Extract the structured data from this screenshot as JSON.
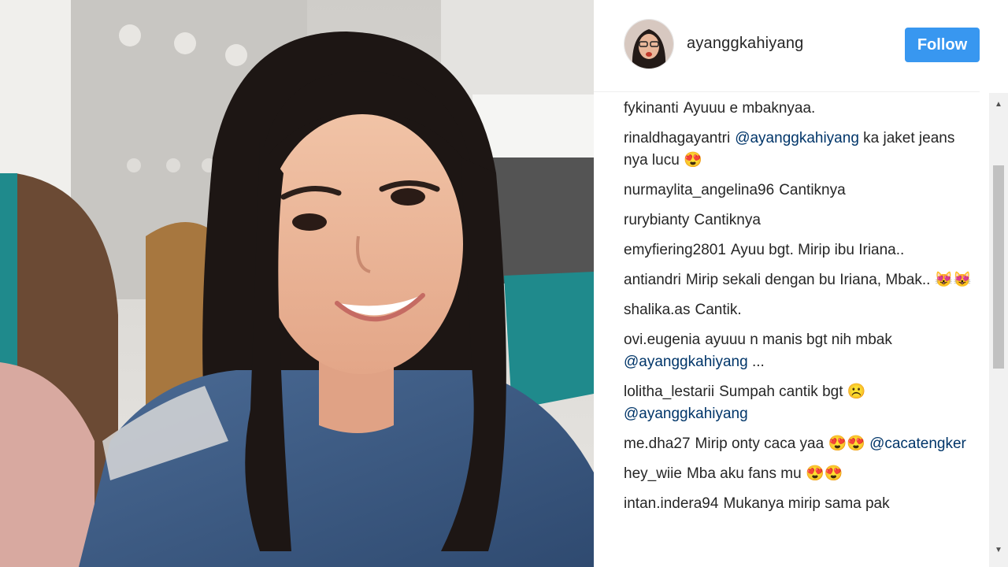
{
  "post": {
    "username": "ayanggkahiyang",
    "follow_label": "Follow"
  },
  "comments": [
    {
      "user": "fykinanti",
      "text": "Ayuuu e mbaknyaa."
    },
    {
      "user": "rinaldhagayantri",
      "mention": "@ayanggkahiyang",
      "text": " ka jaket jeans nya lucu 😍"
    },
    {
      "user": "nurmaylita_angelina96",
      "text": "Cantiknya"
    },
    {
      "user": "rurybianty",
      "text": "Cantiknya"
    },
    {
      "user": "emyfiering2801",
      "text": "Ayuu bgt. Mirip ibu Iriana.."
    },
    {
      "user": "antiandri",
      "text": "Mirip sekali dengan bu Iriana, Mbak.. 😻😻"
    },
    {
      "user": "shalika.as",
      "text": "Cantik."
    },
    {
      "user": "ovi.eugenia",
      "text": "ayuuu n manis bgt nih mbak ",
      "mention_after": "@ayanggkahiyang",
      "text_after": " ..."
    },
    {
      "user": "lolitha_lestarii",
      "text": "Sumpah cantik bgt ☹️ ",
      "mention_after": "@ayanggkahiyang"
    },
    {
      "user": "me.dha27",
      "text": "Mirip onty caca yaa 😍😍 ",
      "mention_after": "@cacatengker"
    },
    {
      "user": "hey_wiie",
      "text": "Mba aku fans mu 😍😍"
    },
    {
      "user": "intan.indera94",
      "text": "Mukanya mirip sama pak"
    }
  ],
  "icons": {
    "scroll_up": "triangle-up",
    "scroll_down": "triangle-down"
  },
  "colors": {
    "follow_button": "#3897f0",
    "mention": "#003569"
  }
}
